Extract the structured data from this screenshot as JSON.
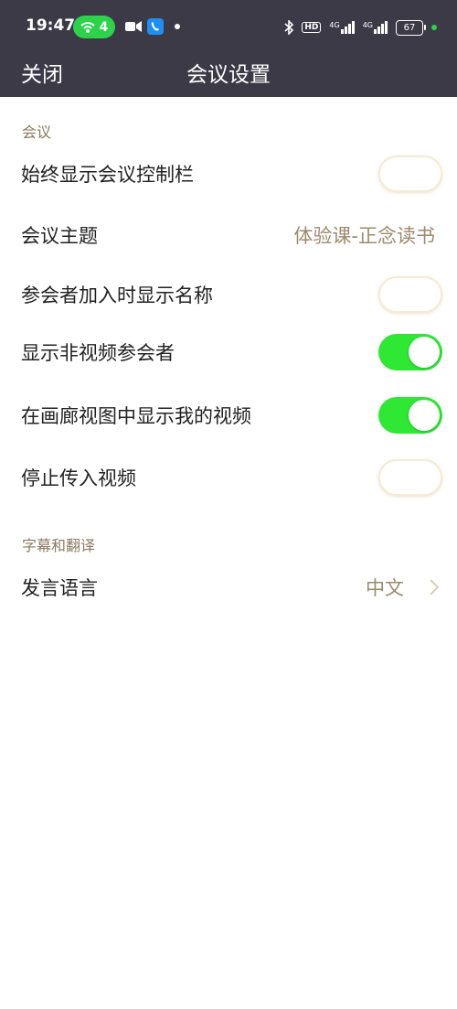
{
  "status": {
    "time": "19:47",
    "hotspot_count": "4",
    "battery": "67",
    "network1": "4G",
    "network2": "4G",
    "hd": "HD"
  },
  "header": {
    "close_label": "关闭",
    "title": "会议设置"
  },
  "sections": {
    "meeting": "会议",
    "captions": "字幕和翻译"
  },
  "settings": [
    {
      "label": "始终显示会议控制栏",
      "toggle": "off"
    },
    {
      "label": "会议主题",
      "value": "体验课-正念读书"
    },
    {
      "label": "参会者加入时显示名称",
      "toggle": "off"
    },
    {
      "label": "显示非视频参会者",
      "toggle": "on"
    },
    {
      "label": "在画廊视图中显示我的视频",
      "toggle": "on"
    },
    {
      "label": "停止传入视频",
      "toggle": "off"
    }
  ],
  "language": {
    "label": "发言语言",
    "value": "中文"
  },
  "colors": {
    "header_bg": "#3c3a47",
    "toggle_on": "#2ee834",
    "accent_text": "#9c8a6c"
  }
}
